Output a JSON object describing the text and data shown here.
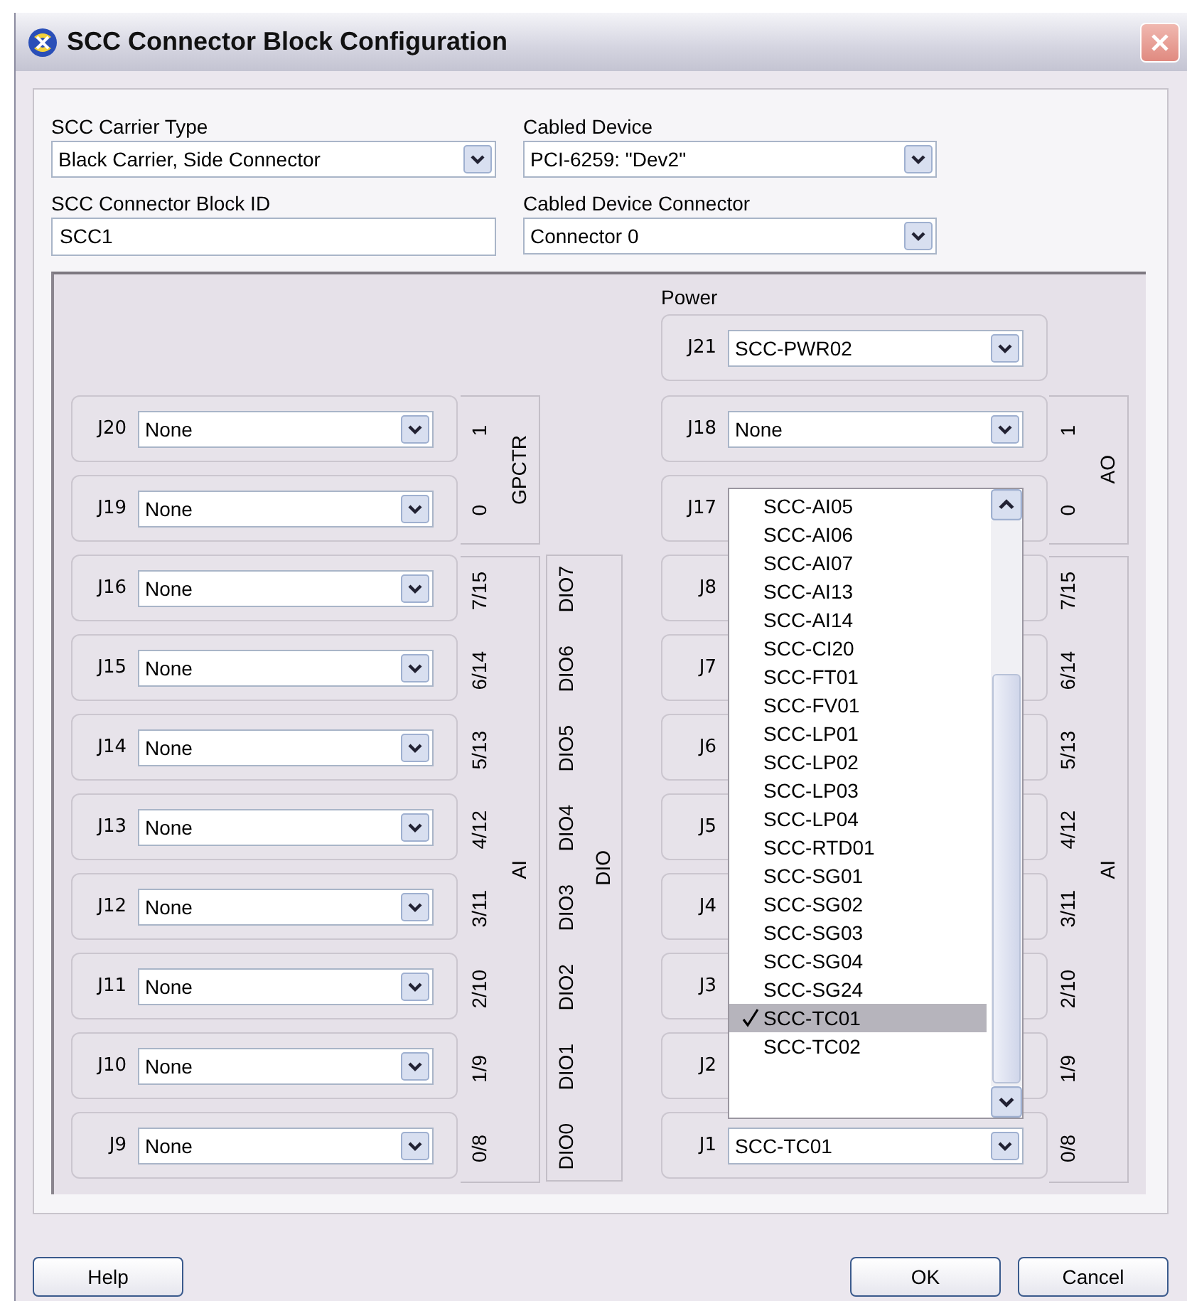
{
  "window": {
    "title": "SCC Connector Block Configuration"
  },
  "settings": [
    {
      "label": "SCC Carrier Type",
      "value": "Black Carrier, Side Connector",
      "kind": "dropdown"
    },
    {
      "label": "Cabled Device",
      "value": "PCI-6259: \"Dev2\"",
      "kind": "dropdown"
    },
    {
      "label": "SCC Connector Block ID",
      "value": "SCC1",
      "kind": "text"
    },
    {
      "label": "Cabled Device Connector",
      "value": "Connector 0",
      "kind": "dropdown"
    }
  ],
  "left": {
    "slots": [
      {
        "id": "J20",
        "value": "None"
      },
      {
        "id": "J19",
        "value": "None"
      },
      {
        "id": "J16",
        "value": "None"
      },
      {
        "id": "J15",
        "value": "None"
      },
      {
        "id": "J14",
        "value": "None"
      },
      {
        "id": "J13",
        "value": "None"
      },
      {
        "id": "J12",
        "value": "None"
      },
      {
        "id": "J11",
        "value": "None"
      },
      {
        "id": "J10",
        "value": "None"
      },
      {
        "id": "J9",
        "value": "None"
      }
    ],
    "groups": [
      {
        "name": "GPCTR",
        "channels": [
          "1",
          "0"
        ]
      },
      {
        "name": "AI",
        "channels": [
          "7/15",
          "6/14",
          "5/13",
          "4/12",
          "3/11",
          "2/10",
          "1/9",
          "0/8"
        ]
      }
    ],
    "dio": {
      "name": "DIO",
      "channels": [
        "DIO7",
        "DIO6",
        "DIO5",
        "DIO4",
        "DIO3",
        "DIO2",
        "DIO1",
        "DIO0"
      ]
    }
  },
  "right": {
    "power": {
      "label": "Power",
      "slot": {
        "id": "J21",
        "value": "SCC-PWR02"
      }
    },
    "slots": [
      {
        "id": "J18",
        "value": "None"
      },
      {
        "id": "J17"
      },
      {
        "id": "J8"
      },
      {
        "id": "J7"
      },
      {
        "id": "J6"
      },
      {
        "id": "J5"
      },
      {
        "id": "J4"
      },
      {
        "id": "J3"
      },
      {
        "id": "J2"
      },
      {
        "id": "J1",
        "value": "SCC-TC01"
      }
    ],
    "groups": [
      {
        "name": "AO",
        "channels": [
          "1",
          "0"
        ]
      },
      {
        "name": "AI",
        "channels": [
          "7/15",
          "6/14",
          "5/13",
          "4/12",
          "3/11",
          "2/10",
          "1/9",
          "0/8"
        ]
      }
    ]
  },
  "dropdown": {
    "items": [
      {
        "label": "SCC-AI05",
        "selected": false
      },
      {
        "label": "SCC-AI06",
        "selected": false
      },
      {
        "label": "SCC-AI07",
        "selected": false
      },
      {
        "label": "SCC-AI13",
        "selected": false
      },
      {
        "label": "SCC-AI14",
        "selected": false
      },
      {
        "label": "SCC-CI20",
        "selected": false
      },
      {
        "label": "SCC-FT01",
        "selected": false
      },
      {
        "label": "SCC-FV01",
        "selected": false
      },
      {
        "label": "SCC-LP01",
        "selected": false
      },
      {
        "label": "SCC-LP02",
        "selected": false
      },
      {
        "label": "SCC-LP03",
        "selected": false
      },
      {
        "label": "SCC-LP04",
        "selected": false
      },
      {
        "label": "SCC-RTD01",
        "selected": false
      },
      {
        "label": "SCC-SG01",
        "selected": false
      },
      {
        "label": "SCC-SG02",
        "selected": false
      },
      {
        "label": "SCC-SG03",
        "selected": false
      },
      {
        "label": "SCC-SG04",
        "selected": false
      },
      {
        "label": "SCC-SG24",
        "selected": false
      },
      {
        "label": "SCC-TC01",
        "selected": true
      },
      {
        "label": "SCC-TC02",
        "selected": false
      }
    ]
  },
  "buttons": {
    "left": [
      "Help"
    ],
    "right": [
      "OK",
      "Cancel"
    ]
  }
}
